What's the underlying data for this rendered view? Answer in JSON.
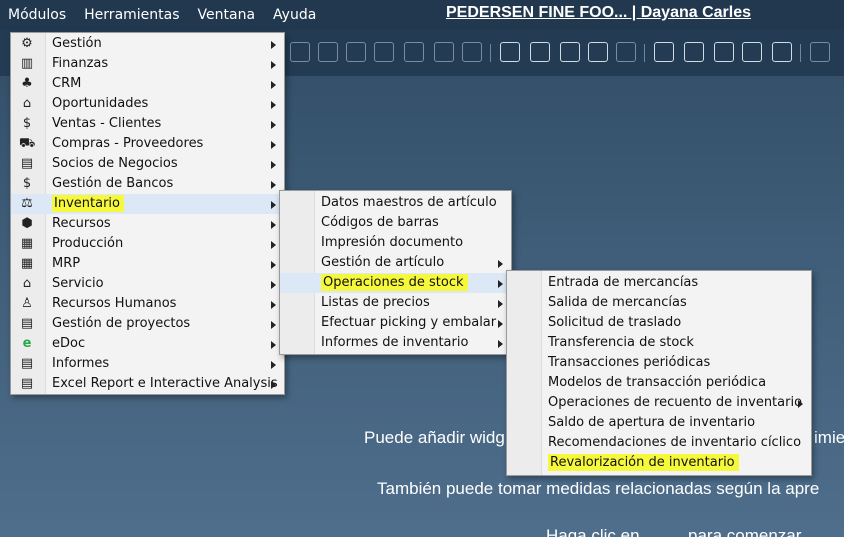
{
  "menubar": [
    {
      "label": "Módulos"
    },
    {
      "label": "Herramientas"
    },
    {
      "label": "Ventana"
    },
    {
      "label": "Ayuda"
    }
  ],
  "company": "PEDERSEN FINE FOO... | Dayana Carles",
  "background": {
    "line1": "Puede añadir widg",
    "line1_right": "imie",
    "line2": "También puede tomar medidas relacionadas según la apre",
    "line3": "Haga clic en",
    "line3_right": "para comenzar"
  },
  "modules_menu": [
    {
      "label": "Gestión",
      "icon": "gear-icon",
      "glyph": "⚙"
    },
    {
      "label": "Finanzas",
      "icon": "finance-icon",
      "glyph": "▥"
    },
    {
      "label": "CRM",
      "icon": "crm-icon",
      "glyph": "♣"
    },
    {
      "label": "Oportunidades",
      "icon": "opportunities-icon",
      "glyph": "⌂"
    },
    {
      "label": "Ventas - Clientes",
      "icon": "sales-icon",
      "glyph": "$"
    },
    {
      "label": "Compras - Proveedores",
      "icon": "cart-icon",
      "glyph": "⛟"
    },
    {
      "label": "Socios de Negocios",
      "icon": "partners-icon",
      "glyph": "▤"
    },
    {
      "label": "Gestión de Bancos",
      "icon": "bank-money-icon",
      "glyph": "$"
    },
    {
      "label": "Inventario",
      "icon": "inventory-icon",
      "glyph": "⚖"
    },
    {
      "label": "Recursos",
      "icon": "resources-icon",
      "glyph": "⬢"
    },
    {
      "label": "Producción",
      "icon": "production-icon",
      "glyph": "▦"
    },
    {
      "label": "MRP",
      "icon": "calendar-icon",
      "glyph": "▦"
    },
    {
      "label": "Servicio",
      "icon": "service-icon",
      "glyph": "⌂"
    },
    {
      "label": "Recursos Humanos",
      "icon": "person-icon",
      "glyph": "♙"
    },
    {
      "label": "Gestión de proyectos",
      "icon": "project-icon",
      "glyph": "▤"
    },
    {
      "label": "eDoc",
      "icon": "edoc-icon",
      "glyph": "e"
    },
    {
      "label": "Informes",
      "icon": "report-icon",
      "glyph": "▤"
    },
    {
      "label": "Excel Report e Interactive Analysis",
      "icon": "excel-report-icon",
      "glyph": "▤"
    }
  ],
  "inventory_menu": [
    {
      "label": "Datos maestros de artículo"
    },
    {
      "label": "Códigos de barras"
    },
    {
      "label": "Impresión documento"
    },
    {
      "label": "Gestión de artículo"
    },
    {
      "label": "Operaciones de stock"
    },
    {
      "label": "Listas de precios"
    },
    {
      "label": "Efectuar picking y embalar"
    },
    {
      "label": "Informes de inventario"
    }
  ],
  "stock_menu": [
    {
      "label": "Entrada de mercancías"
    },
    {
      "label": "Salida de mercancías"
    },
    {
      "label": "Solicitud de traslado"
    },
    {
      "label": "Transferencia de stock"
    },
    {
      "label": "Transacciones periódicas"
    },
    {
      "label": "Modelos de transacción periódica"
    },
    {
      "label": "Operaciones de recuento de inventario"
    },
    {
      "label": "Saldo de apertura de inventario"
    },
    {
      "label": "Recomendaciones de inventario cíclico"
    },
    {
      "label": "Revalorización de inventario"
    }
  ],
  "colors": {
    "highlight": "#f6f83c",
    "menu_bg": "#f3f3f3",
    "topbar": "#21384f"
  }
}
